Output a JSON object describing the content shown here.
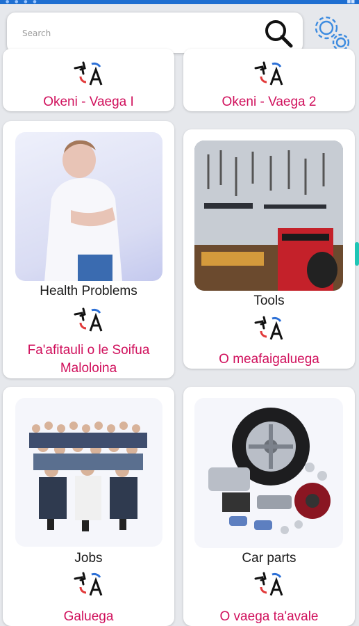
{
  "search": {
    "placeholder": "Search"
  },
  "cards": [
    {
      "label_en": "",
      "label_sm": "Okeni - Vaega I"
    },
    {
      "label_en": "",
      "label_sm": "Okeni - Vaega 2"
    },
    {
      "label_en": "Health Problems",
      "label_sm": "Fa'afitauli o le Soifua Maloloina"
    },
    {
      "label_en": "Tools",
      "label_sm": "O meafaigaluega"
    },
    {
      "label_en": "Jobs",
      "label_sm": "Galuega"
    },
    {
      "label_en": "Car parts",
      "label_sm": "O vaega ta'avale"
    }
  ],
  "colors": {
    "accent_red": "#d0105c",
    "status_bar": "#1f6fd1",
    "gear": "#3c8be0",
    "scroll_thumb": "#1fc6b6"
  },
  "icons": [
    "search-icon",
    "gear-icon",
    "translate-logo-icon"
  ]
}
